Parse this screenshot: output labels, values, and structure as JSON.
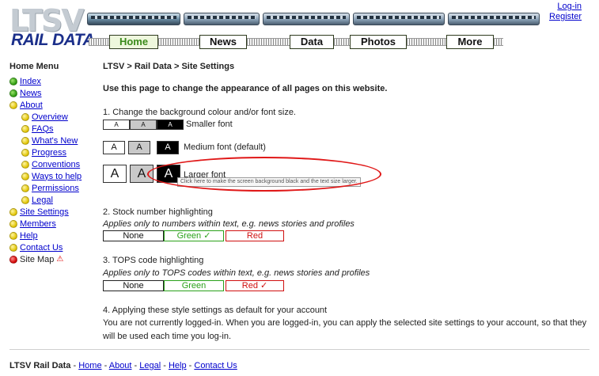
{
  "header": {
    "logo_text": "LTSV",
    "logo_subtitle": "RAIL DATA",
    "nav": [
      {
        "label": "Home",
        "active": true
      },
      {
        "label": "News",
        "active": false
      },
      {
        "label": "Data",
        "active": false
      },
      {
        "label": "Photos",
        "active": false
      },
      {
        "label": "More",
        "active": false
      }
    ],
    "login_label": "Log-in",
    "register_label": "Register"
  },
  "sidebar": {
    "title": "Home Menu",
    "items": [
      {
        "label": "Index",
        "dot": "green",
        "link": true
      },
      {
        "label": "News",
        "dot": "green",
        "link": true
      },
      {
        "label": "About",
        "dot": "yellow",
        "link": true
      },
      {
        "label": "Overview",
        "dot": "yellow",
        "link": true,
        "sub": true
      },
      {
        "label": "FAQs",
        "dot": "yellow",
        "link": true,
        "sub": true
      },
      {
        "label": "What's New",
        "dot": "yellow",
        "link": true,
        "sub": true
      },
      {
        "label": "Progress",
        "dot": "yellow",
        "link": true,
        "sub": true
      },
      {
        "label": "Conventions",
        "dot": "yellow",
        "link": true,
        "sub": true
      },
      {
        "label": "Ways to help",
        "dot": "yellow",
        "link": true,
        "sub": true
      },
      {
        "label": "Permissions",
        "dot": "yellow",
        "link": true,
        "sub": true
      },
      {
        "label": "Legal",
        "dot": "yellow",
        "link": true,
        "sub": true
      },
      {
        "label": "Site Settings",
        "dot": "yellow",
        "link": true
      },
      {
        "label": "Members",
        "dot": "yellow",
        "link": true
      },
      {
        "label": "Help",
        "dot": "yellow",
        "link": true
      },
      {
        "label": "Contact Us",
        "dot": "yellow",
        "link": true
      },
      {
        "label": "Site Map",
        "dot": "red",
        "link": false,
        "warning_icon": "warning-triangle-icon"
      }
    ]
  },
  "main": {
    "breadcrumb": "LTSV > Rail Data > Site Settings",
    "intro": "Use this page to change the appearance of all pages on this website.",
    "section1": {
      "title": "1. Change the background colour and/or font size.",
      "button_letter": "A",
      "small_label": "Smaller font",
      "medium_label": "Medium font (default)",
      "large_label": "Larger font",
      "tooltip": "Click here to make the screen background black and the text size larger."
    },
    "section2": {
      "title": "2. Stock number highlighting",
      "note": "Applies only to numbers within text, e.g. news stories and profiles",
      "options": [
        "None",
        "Green ✓",
        "Red"
      ]
    },
    "section3": {
      "title": "3. TOPS code highlighting",
      "note": "Applies only to TOPS codes within text, e.g. news stories and profiles",
      "options": [
        "None",
        "Green",
        "Red ✓"
      ]
    },
    "section4": {
      "title": "4. Applying these style settings as default for your account",
      "text": "You are not currently logged-in. When you are logged-in, you can apply the selected site settings to your account, so that they will be used each time you log-in."
    }
  },
  "footer": {
    "brand": "LTSV Rail Data",
    "separator": " - ",
    "links": [
      "Home",
      "About",
      "Legal",
      "Help",
      "Contact Us"
    ]
  },
  "colors": {
    "accent_green": "#2aa11a",
    "accent_red": "#d01010",
    "link_blue": "#0000cc",
    "logo_blue": "#1b2f8a",
    "annotation_red": "#e01818"
  }
}
